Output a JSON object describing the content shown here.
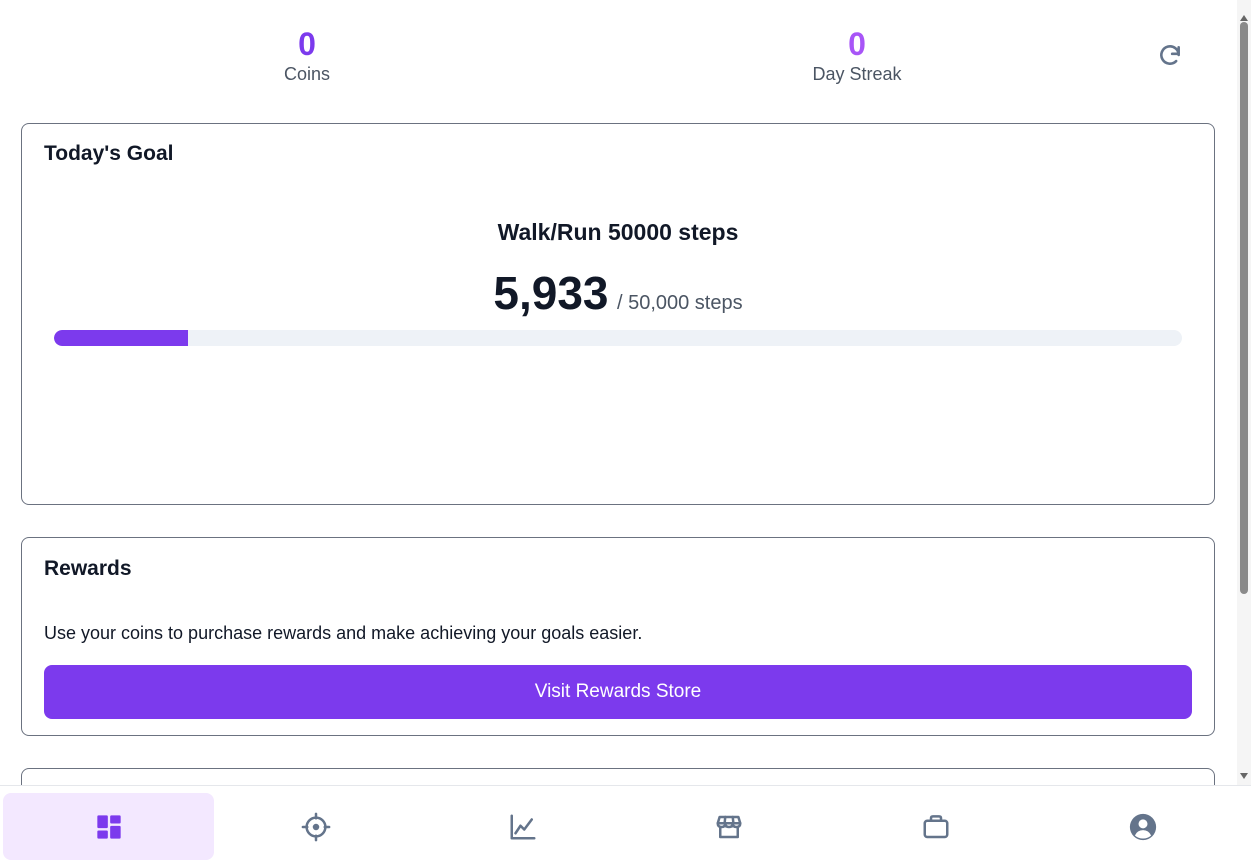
{
  "stats": {
    "coins_value": "0",
    "coins_label": "Coins",
    "streak_value": "0",
    "streak_label": "Day Streak"
  },
  "goal": {
    "title": "Today's Goal",
    "description": "Walk/Run 50000 steps",
    "current_steps": "5,933",
    "total_steps": "/ 50,000 steps",
    "progress_fraction": 0.1187
  },
  "rewards": {
    "title": "Rewards",
    "text": "Use your coins to purchase rewards and make achieving your goals easier.",
    "button_label": "Visit Rewards Store"
  },
  "nav": {
    "items": [
      {
        "icon": "dashboard-icon",
        "active": true
      },
      {
        "icon": "target-icon",
        "active": false
      },
      {
        "icon": "chart-line-icon",
        "active": false
      },
      {
        "icon": "store-icon",
        "active": false
      },
      {
        "icon": "briefcase-icon",
        "active": false
      },
      {
        "icon": "user-circle-icon",
        "active": false
      }
    ]
  },
  "colors": {
    "accent": "#7c3aed",
    "accent_light": "#a855f7",
    "active_nav_bg": "#f3e8ff",
    "icon_gray": "#64748b"
  }
}
